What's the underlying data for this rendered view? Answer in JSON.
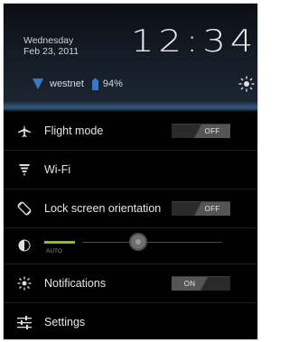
{
  "status": {
    "day": "Wednesday",
    "date": "Feb 23, 2011",
    "time": "12:34",
    "network_name": "westnet",
    "battery_percent": "94%",
    "icons": {
      "signal": "signal-icon",
      "battery": "battery-icon",
      "brightness": "brightness-icon"
    }
  },
  "quick_settings": {
    "flight_mode": {
      "label": "Flight mode",
      "toggle": "OFF",
      "icon": "airplane-icon"
    },
    "wifi": {
      "label": "Wi-Fi",
      "icon": "wifi-icon"
    },
    "lock_orientation": {
      "label": "Lock screen orientation",
      "toggle": "OFF",
      "icon": "screen-rotation-icon"
    },
    "brightness": {
      "auto_label": "AUTO",
      "level": 0.4,
      "icon": "brightness-icon"
    },
    "notifications": {
      "label": "Notifications",
      "toggle": "ON",
      "icon": "notifications-icon"
    },
    "settings": {
      "label": "Settings",
      "icon": "settings-sliders-icon"
    }
  },
  "colors": {
    "background": "#000000",
    "accent_green": "#7fc223",
    "signal_blue": "#3c78c8",
    "text": "#e6e6e6"
  }
}
